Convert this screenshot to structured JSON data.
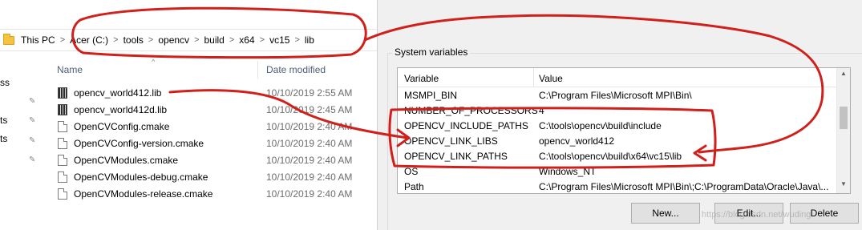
{
  "address": {
    "crumbs": [
      "This PC",
      "Acer (C:)",
      "tools",
      "opencv",
      "build",
      "x64",
      "vc15",
      "lib"
    ],
    "separator": ">"
  },
  "sidepanel": {
    "items": [
      "ss",
      "ts",
      "ts"
    ]
  },
  "file_columns": {
    "name": "Name",
    "date": "Date modified"
  },
  "files": [
    {
      "name": "opencv_world412.lib",
      "date": "10/10/2019 2:55 AM",
      "icon": "lib-file-icon"
    },
    {
      "name": "opencv_world412d.lib",
      "date": "10/10/2019 2:45 AM",
      "icon": "lib-file-icon"
    },
    {
      "name": "OpenCVConfig.cmake",
      "date": "10/10/2019 2:40 AM",
      "icon": "document-icon"
    },
    {
      "name": "OpenCVConfig-version.cmake",
      "date": "10/10/2019 2:40 AM",
      "icon": "document-icon"
    },
    {
      "name": "OpenCVModules.cmake",
      "date": "10/10/2019 2:40 AM",
      "icon": "document-icon"
    },
    {
      "name": "OpenCVModules-debug.cmake",
      "date": "10/10/2019 2:40 AM",
      "icon": "document-icon"
    },
    {
      "name": "OpenCVModules-release.cmake",
      "date": "10/10/2019 2:40 AM",
      "icon": "document-icon"
    }
  ],
  "dialog": {
    "group_title": "System variables",
    "columns": {
      "variable": "Variable",
      "value": "Value"
    },
    "variables": [
      {
        "name": "MSMPI_BIN",
        "value": "C:\\Program Files\\Microsoft MPI\\Bin\\"
      },
      {
        "name": "NUMBER_OF_PROCESSORS",
        "value": "4"
      },
      {
        "name": "OPENCV_INCLUDE_PATHS",
        "value": "C:\\tools\\opencv\\build\\include"
      },
      {
        "name": "OPENCV_LINK_LIBS",
        "value": "opencv_world412"
      },
      {
        "name": "OPENCV_LINK_PATHS",
        "value": "C:\\tools\\opencv\\build\\x64\\vc15\\lib"
      },
      {
        "name": "OS",
        "value": "Windows_NT"
      },
      {
        "name": "Path",
        "value": "C:\\Program Files\\Microsoft MPI\\Bin\\;C:\\ProgramData\\Oracle\\Java\\..."
      }
    ],
    "buttons": {
      "new": "New...",
      "edit": "Edit...",
      "delete": "Delete"
    }
  },
  "watermark": "https://blog.csdn.net/wuding",
  "colors": {
    "annotation": "#d0201c",
    "header_text": "#4c607a",
    "dialog_bg": "#f0f0f0"
  }
}
